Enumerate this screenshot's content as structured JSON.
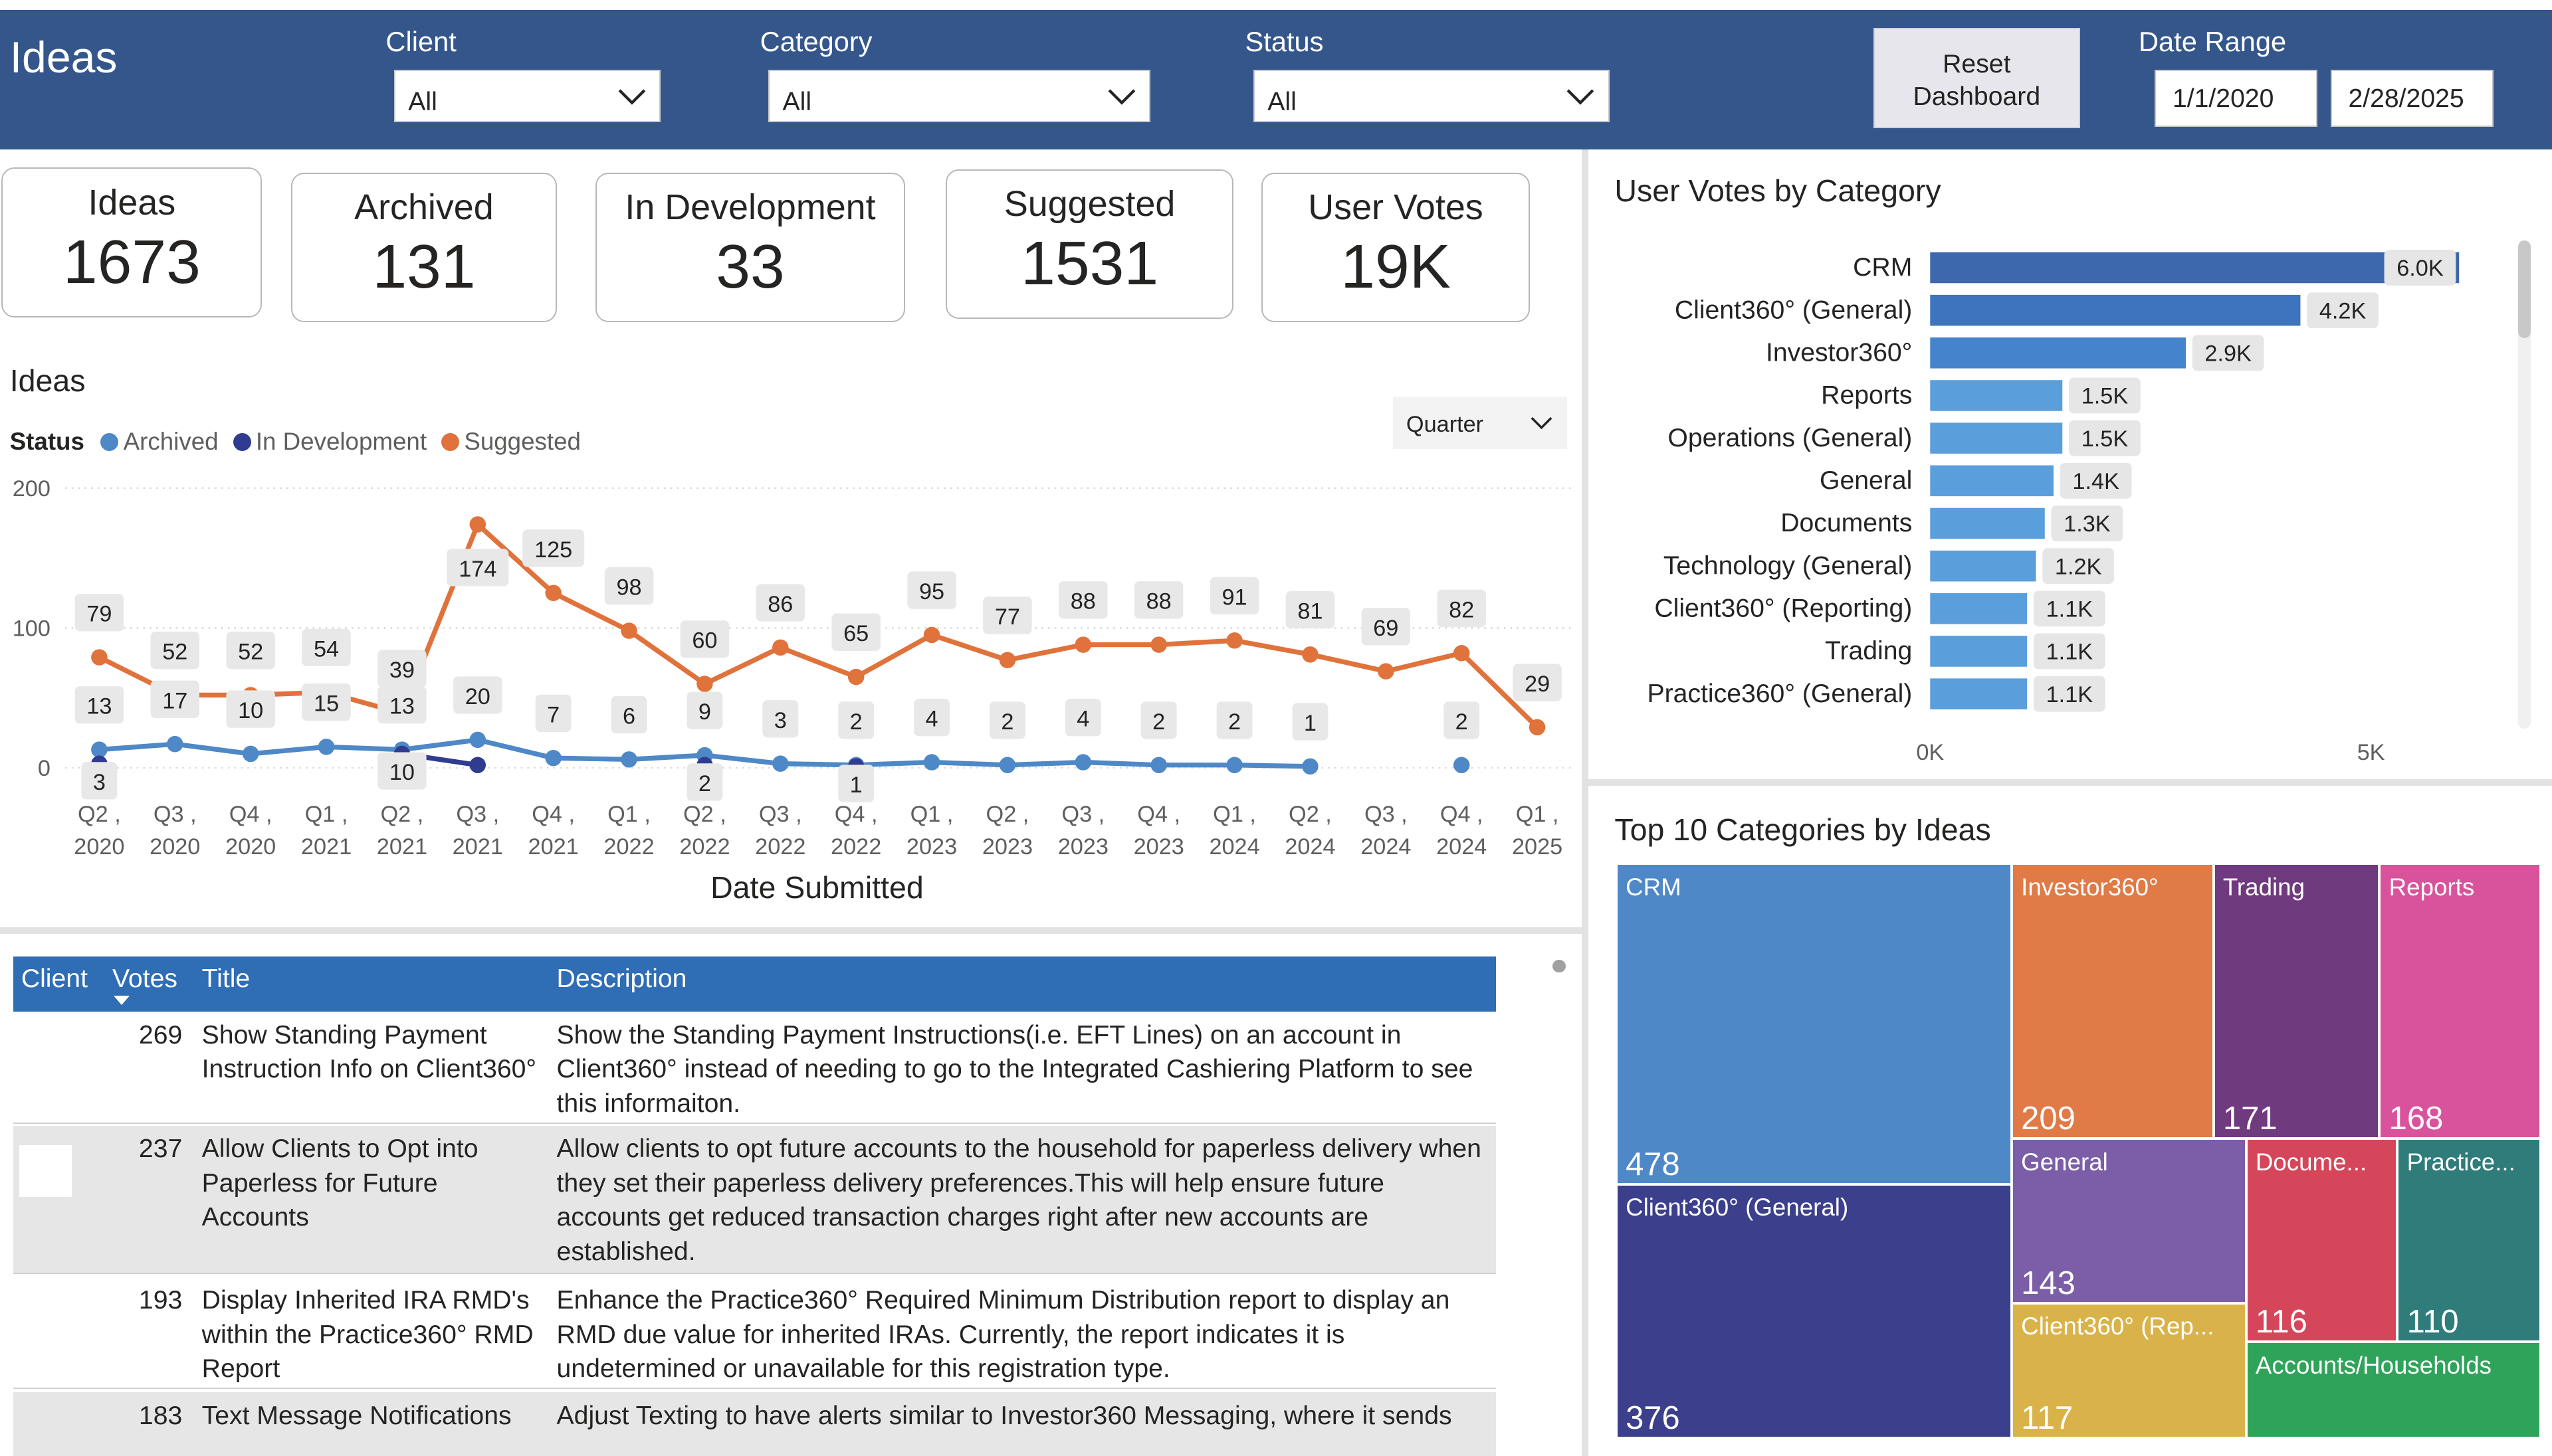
{
  "header": {
    "title": "Ideas",
    "filters": [
      {
        "label": "Client",
        "value": "All"
      },
      {
        "label": "Category",
        "value": "All"
      },
      {
        "label": "Status",
        "value": "All"
      }
    ],
    "reset_label_1": "Reset",
    "reset_label_2": "Dashboard",
    "date_range_label": "Date Range",
    "date_start": "1/1/2020",
    "date_end": "2/28/2025"
  },
  "kpis": [
    {
      "label": "Ideas",
      "value": "1673"
    },
    {
      "label": "Archived",
      "value": "131"
    },
    {
      "label": "In Development",
      "value": "33"
    },
    {
      "label": "Suggested",
      "value": "1531"
    },
    {
      "label": "User Votes",
      "value": "19K"
    }
  ],
  "ideas_chart": {
    "section_title": "Ideas",
    "legend_title": "Status",
    "granularity": "Quarter",
    "xlabel": "Date Submitted"
  },
  "votes_chart": {
    "section_title": "User Votes by Category"
  },
  "treemap": {
    "section_title": "Top 10 Categories by Ideas",
    "cells": [
      {
        "name": "CRM",
        "value": "478",
        "color": "#4e88c7"
      },
      {
        "name": "Client360° (General)",
        "value": "376",
        "color": "#3b3f8c"
      },
      {
        "name": "Investor360°",
        "value": "209",
        "color": "#e07a46"
      },
      {
        "name": "Trading",
        "value": "171",
        "color": "#6f3a7e"
      },
      {
        "name": "Reports",
        "value": "168",
        "color": "#d9539c"
      },
      {
        "name": "General",
        "value": "143",
        "color": "#7b5ea7"
      },
      {
        "name": "Client360° (Rep...",
        "value": "117",
        "color": "#d9b34a"
      },
      {
        "name": "Docume...",
        "value": "116",
        "color": "#d6465a"
      },
      {
        "name": "Practice...",
        "value": "110",
        "color": "#2f7c7a"
      },
      {
        "name": "Accounts/Households",
        "value": "",
        "color": "#2fa35a"
      }
    ]
  },
  "table": {
    "headers": {
      "client": "Client",
      "votes": "Votes",
      "title": "Title",
      "description": "Description"
    },
    "rows": [
      {
        "votes": "269",
        "title": "Show Standing Payment Instruction Info on Client360°",
        "description": "Show the Standing Payment Instructions(i.e. EFT Lines) on an account in Client360° instead of needing to go to the Integrated Cashiering Platform to see this informaiton."
      },
      {
        "votes": "237",
        "title": "Allow Clients to Opt into Paperless for Future Accounts",
        "description": "Allow clients to opt future accounts to the household for paperless delivery when they set their paperless delivery preferences.This will help ensure future accounts get reduced transaction charges right after new accounts are established."
      },
      {
        "votes": "193",
        "title": "Display Inherited IRA RMD's within the Practice360° RMD Report",
        "description": "Enhance the Practice360° Required Minimum Distribution report to display an RMD due value for inherited IRAs. Currently, the report indicates it is undetermined or unavailable for this registration type."
      },
      {
        "votes": "183",
        "title": "Text Message Notifications",
        "description": "Adjust Texting to have alerts similar to Investor360 Messaging, where it sends"
      }
    ]
  },
  "colors": {
    "header_bg": "#34568b",
    "archived": "#4e88c7",
    "in_development": "#2f3c8f",
    "suggested": "#e0723c",
    "table_header": "#2f6db5"
  },
  "chart_data": [
    {
      "type": "line",
      "title": "Ideas",
      "xlabel": "Date Submitted",
      "ylabel": "",
      "ylim": [
        0,
        200
      ],
      "y_ticks": [
        "0",
        "100",
        "200"
      ],
      "legend_title": "Status",
      "legend_position": "top-left",
      "grid": true,
      "x": [
        "Q2 , 2020",
        "Q3 , 2020",
        "Q4 , 2020",
        "Q1 , 2021",
        "Q2 , 2021",
        "Q3 , 2021",
        "Q4 , 2021",
        "Q1 , 2022",
        "Q2 , 2022",
        "Q3 , 2022",
        "Q4 , 2022",
        "Q1 , 2023",
        "Q2 , 2023",
        "Q3 , 2023",
        "Q4 , 2023",
        "Q1 , 2024",
        "Q2 , 2024",
        "Q3 , 2024",
        "Q4 , 2024",
        "Q1 , 2025"
      ],
      "series": [
        {
          "name": "Archived",
          "color": "#4e88c7",
          "values": [
            13,
            17,
            10,
            15,
            13,
            20,
            7,
            6,
            9,
            3,
            2,
            4,
            2,
            4,
            2,
            2,
            1,
            null,
            2,
            null
          ],
          "labels": [
            13,
            17,
            10,
            15,
            13,
            20,
            7,
            6,
            9,
            3,
            2,
            4,
            2,
            4,
            2,
            2,
            1,
            null,
            2,
            null
          ]
        },
        {
          "name": "In Development",
          "color": "#2f3c8f",
          "values": [
            3,
            null,
            null,
            null,
            10,
            2,
            null,
            null,
            2,
            null,
            1,
            null,
            null,
            null,
            null,
            null,
            null,
            null,
            null,
            null
          ],
          "labels": [
            3,
            null,
            null,
            null,
            10,
            null,
            null,
            null,
            2,
            null,
            1,
            null,
            null,
            null,
            null,
            null,
            null,
            null,
            null,
            null
          ]
        },
        {
          "name": "Suggested",
          "color": "#e0723c",
          "values": [
            79,
            52,
            52,
            54,
            39,
            174,
            125,
            98,
            60,
            86,
            65,
            95,
            77,
            88,
            88,
            91,
            81,
            69,
            82,
            29
          ],
          "labels": [
            79,
            52,
            52,
            54,
            39,
            174,
            125,
            98,
            60,
            86,
            65,
            95,
            77,
            88,
            88,
            91,
            81,
            69,
            82,
            29
          ]
        }
      ]
    },
    {
      "type": "bar",
      "orientation": "horizontal",
      "title": "User Votes by Category",
      "categories": [
        "CRM",
        "Client360° (General)",
        "Investor360°",
        "Reports",
        "Operations (General)",
        "General",
        "Documents",
        "Technology (General)",
        "Client360° (Reporting)",
        "Trading",
        "Practice360° (General)"
      ],
      "values": [
        6000,
        4200,
        2900,
        1500,
        1500,
        1400,
        1300,
        1200,
        1100,
        1100,
        1100
      ],
      "data_labels": [
        "6.0K",
        "4.2K",
        "2.9K",
        "1.5K",
        "1.5K",
        "1.4K",
        "1.3K",
        "1.2K",
        "1.1K",
        "1.1K",
        "1.1K"
      ],
      "x_ticks": [
        "0K",
        "5K"
      ],
      "xlim": [
        0,
        6000
      ],
      "colors": [
        "#3d68ad",
        "#3d74bd",
        "#4584cc",
        "#5a9edc",
        "#5a9edc",
        "#5a9edc",
        "#5a9edc",
        "#5a9edc",
        "#5a9edc",
        "#5a9edc",
        "#5a9edc"
      ]
    }
  ]
}
